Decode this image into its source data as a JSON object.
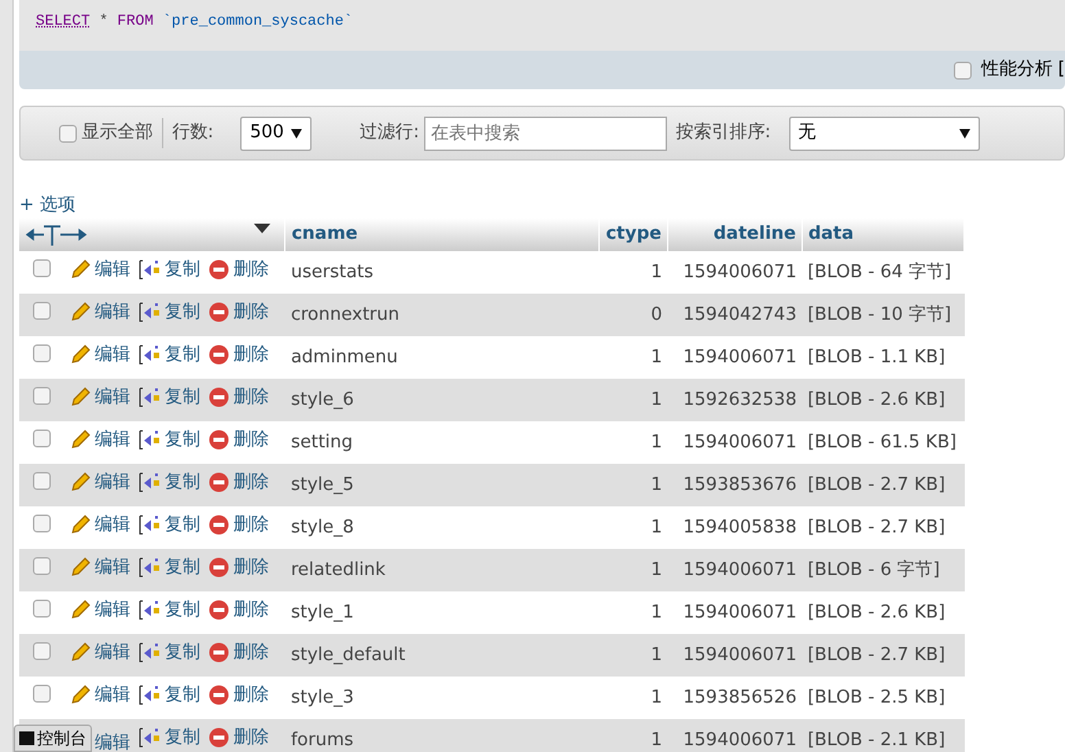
{
  "sql": {
    "keyword1": "SELECT",
    "rest": " * ",
    "keyword2": "FROM",
    "table": "`pre_common_syscache`"
  },
  "profiling": {
    "label": "性能分析 [",
    "checked": false
  },
  "toolbar": {
    "show_all": {
      "label": "显示全部",
      "checked": false
    },
    "rows_label": "行数:",
    "rows_value": "500",
    "filter_label": "过滤行:",
    "filter_placeholder": "在表中搜索",
    "sort_label": "按索引排序:",
    "sort_value": "无"
  },
  "options_link": "+ 选项",
  "table": {
    "columns": [
      "cname",
      "ctype",
      "dateline",
      "data"
    ],
    "rows": [
      {
        "actions": [
          "编辑",
          "复制",
          "删除"
        ],
        "cname": "userstats",
        "ctype": "1",
        "dateline": "1594006071",
        "data": "[BLOB - 64 字节]",
        "checked": false
      },
      {
        "actions": [
          "编辑",
          "复制",
          "删除"
        ],
        "cname": "cronnextrun",
        "ctype": "0",
        "dateline": "1594042743",
        "data": "[BLOB - 10 字节]",
        "checked": false
      },
      {
        "actions": [
          "编辑",
          "复制",
          "删除"
        ],
        "cname": "adminmenu",
        "ctype": "1",
        "dateline": "1594006071",
        "data": "[BLOB - 1.1 KB]",
        "checked": false
      },
      {
        "actions": [
          "编辑",
          "复制",
          "删除"
        ],
        "cname": "style_6",
        "ctype": "1",
        "dateline": "1592632538",
        "data": "[BLOB - 2.6 KB]",
        "checked": false
      },
      {
        "actions": [
          "编辑",
          "复制",
          "删除"
        ],
        "cname": "setting",
        "ctype": "1",
        "dateline": "1594006071",
        "data": "[BLOB - 61.5 KB]",
        "checked": false
      },
      {
        "actions": [
          "编辑",
          "复制",
          "删除"
        ],
        "cname": "style_5",
        "ctype": "1",
        "dateline": "1593853676",
        "data": "[BLOB - 2.7 KB]",
        "checked": false
      },
      {
        "actions": [
          "编辑",
          "复制",
          "删除"
        ],
        "cname": "style_8",
        "ctype": "1",
        "dateline": "1594005838",
        "data": "[BLOB - 2.7 KB]",
        "checked": false
      },
      {
        "actions": [
          "编辑",
          "复制",
          "删除"
        ],
        "cname": "relatedlink",
        "ctype": "1",
        "dateline": "1594006071",
        "data": "[BLOB - 6 字节]",
        "checked": false
      },
      {
        "actions": [
          "编辑",
          "复制",
          "删除"
        ],
        "cname": "style_1",
        "ctype": "1",
        "dateline": "1594006071",
        "data": "[BLOB - 2.6 KB]",
        "checked": false
      },
      {
        "actions": [
          "编辑",
          "复制",
          "删除"
        ],
        "cname": "style_default",
        "ctype": "1",
        "dateline": "1594006071",
        "data": "[BLOB - 2.7 KB]",
        "checked": false
      },
      {
        "actions": [
          "编辑",
          "复制",
          "删除"
        ],
        "cname": "style_3",
        "ctype": "1",
        "dateline": "1593856526",
        "data": "[BLOB - 2.5 KB]",
        "checked": false
      },
      {
        "actions": [
          "编辑",
          "复制",
          "删除"
        ],
        "cname": "forums",
        "ctype": "1",
        "dateline": "1594006071",
        "data": "[BLOB - 2.1 KB]",
        "covered_by_console": true
      }
    ]
  },
  "console_button": "控制台"
}
